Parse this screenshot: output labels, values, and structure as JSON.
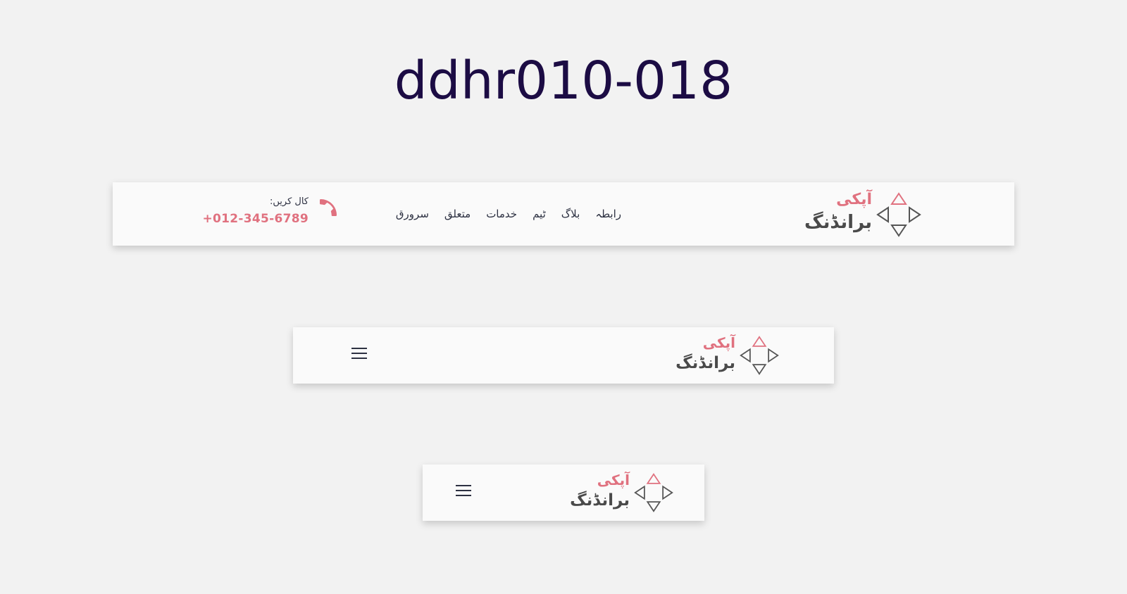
{
  "page": {
    "title": "ddhr010-018"
  },
  "brand": {
    "line1": "آپکی",
    "line2": "برانڈنگ",
    "accent_color": "#e0717f",
    "text_color": "#4a4a4a"
  },
  "nav_desktop": {
    "menu": [
      {
        "label": "سرورق"
      },
      {
        "label": "متعلق"
      },
      {
        "label": "خدمات"
      },
      {
        "label": "ٹیم"
      },
      {
        "label": "بلاگ"
      },
      {
        "label": "رابطہ"
      }
    ],
    "call_label": "کال کریں:",
    "phone": "+012-345-6789",
    "phone_icon": "phone-icon"
  },
  "nav_tablet": {
    "menu_icon": "hamburger-menu-icon"
  },
  "nav_mobile": {
    "menu_icon": "hamburger-menu-icon"
  }
}
